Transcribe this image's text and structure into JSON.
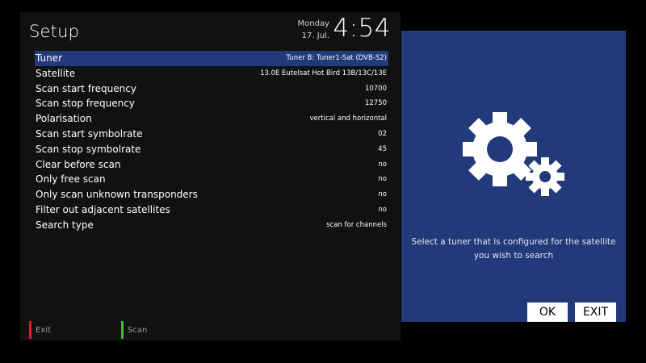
{
  "header": {
    "title": "Setup",
    "day": "Monday",
    "date": "17. Jul.",
    "time": "4:54"
  },
  "menu": {
    "items": [
      {
        "label": "Tuner",
        "value": "Tuner B: Tuner1-Sat (DVB-S2)",
        "selected": true
      },
      {
        "label": "Satellite",
        "value": "13.0E Eutelsat Hot Bird 13B/13C/13E"
      },
      {
        "label": "Scan start frequency",
        "value": "10700"
      },
      {
        "label": "Scan stop frequency",
        "value": "12750"
      },
      {
        "label": "Polarisation",
        "value": "vertical and horizontal"
      },
      {
        "label": "Scan start symbolrate",
        "value": "02"
      },
      {
        "label": "Scan stop symbolrate",
        "value": "45"
      },
      {
        "label": "Clear before scan",
        "value": "no"
      },
      {
        "label": "Only free scan",
        "value": "no"
      },
      {
        "label": "Only scan unknown transponders",
        "value": "no"
      },
      {
        "label": "Filter out adjacent satellites",
        "value": "no"
      },
      {
        "label": "Search type",
        "value": "scan for channels"
      }
    ]
  },
  "footer": {
    "exit_label": "Exit",
    "scan_label": "Scan",
    "exit_color": "#e02020",
    "scan_color": "#3fbf2f"
  },
  "side_panel": {
    "icon": "gears-icon",
    "help_line1": "Select a tuner that is configured for the satellite",
    "help_line2": "you wish to search",
    "ok_label": "OK",
    "exit_label": "EXIT"
  },
  "colors": {
    "selection": "#223a7a",
    "panel": "#233a7a",
    "background": "#111111"
  }
}
